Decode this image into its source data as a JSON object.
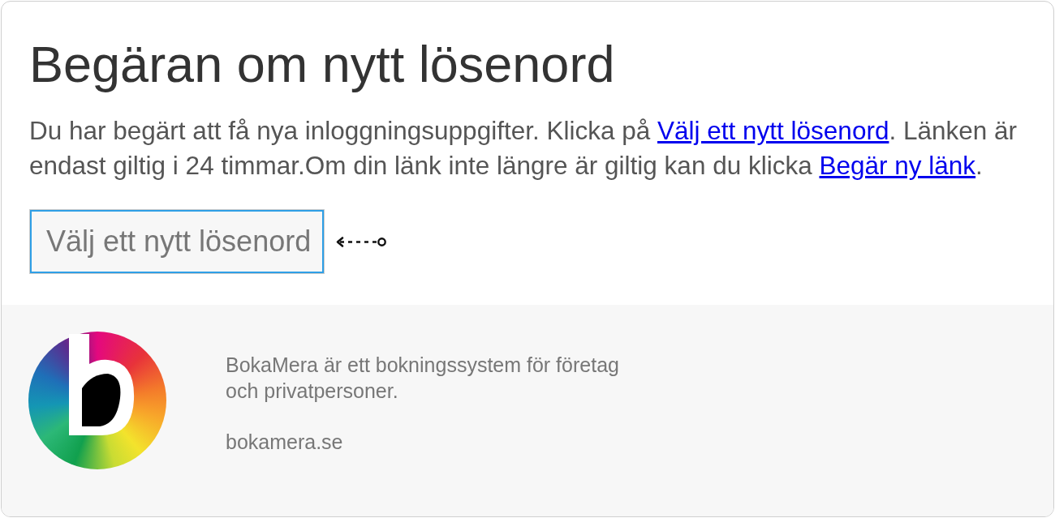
{
  "page": {
    "title": "Begäran om nytt lösenord"
  },
  "intro": {
    "parts": [
      {
        "kind": "text",
        "text": "Du har begärt att få nya inloggningsuppgifter. Klicka på "
      },
      {
        "kind": "link",
        "text": "Välj ett nytt lösenord"
      },
      {
        "kind": "text",
        "text": ". Länken är endast giltig i 24 timmar.Om din länk inte längre är giltig kan du klicka "
      },
      {
        "kind": "link",
        "text": "Begär ny länk"
      },
      {
        "kind": "text",
        "text": "."
      }
    ]
  },
  "password_field": {
    "placeholder": "Välj ett nytt lösenord",
    "focused": true
  },
  "footer": {
    "description": "BokaMera är ett bokningssystem för företag och privatpersoner.",
    "website": "bokamera.se"
  }
}
